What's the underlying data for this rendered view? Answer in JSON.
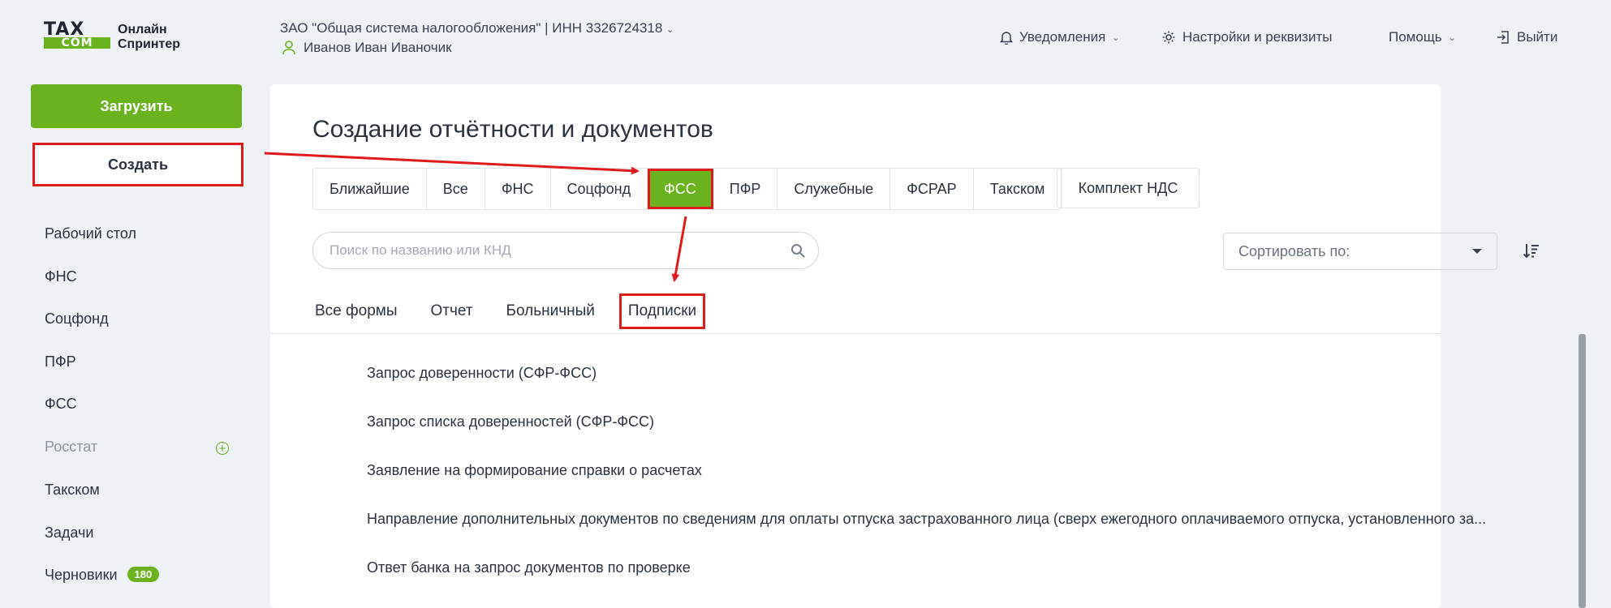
{
  "logo": {
    "word1": "TAX",
    "word2": "COM",
    "line1": "Онлайн",
    "line2": "Спринтер"
  },
  "header": {
    "org": "ЗАО \"Общая система налогообложения\" | ИНН 3326724318",
    "user": "Иванов Иван Иваночик",
    "notifications": "Уведомления",
    "settings": "Настройки и реквизиты",
    "help": "Помощь",
    "logout": "Выйти"
  },
  "sidebar": {
    "upload": "Загрузить",
    "create": "Создать",
    "items": [
      {
        "label": "Рабочий стол"
      },
      {
        "label": "ФНС"
      },
      {
        "label": "Соцфонд"
      },
      {
        "label": "ПФР"
      },
      {
        "label": "ФСС"
      },
      {
        "label": "Росстат"
      },
      {
        "label": "Такском"
      },
      {
        "label": "Задачи"
      },
      {
        "label": "Черновики",
        "badge": "180"
      }
    ]
  },
  "main": {
    "title": "Создание отчётности и документов",
    "tabs": [
      "Ближайшие",
      "Все",
      "ФНС",
      "Соцфонд",
      "ФСС",
      "ПФР",
      "Служебные",
      "ФСРАР",
      "Такском"
    ],
    "active_tab": "ФСС",
    "extra_tab": "Комплект НДС",
    "search_placeholder": "Поиск по названию или КНД",
    "sort_label": "Сортировать по:",
    "subtabs": [
      "Все формы",
      "Отчет",
      "Больничный",
      "Подписки"
    ],
    "active_subtab": "Подписки",
    "forms": [
      "Запрос доверенности (СФР-ФСС)",
      "Запрос списка доверенностей (СФР-ФСС)",
      "Заявление на формирование справки о расчетах",
      "Направление дополнительных документов по сведениям для оплаты отпуска застрахованного лица (сверх ежегодного оплачиваемого отпуска, установленного за...",
      "Ответ банка на запрос документов по проверке"
    ]
  },
  "colors": {
    "accent": "#6ab21e",
    "highlight": "#e01b1b",
    "text": "#2b3340",
    "background": "#eff2f5"
  }
}
